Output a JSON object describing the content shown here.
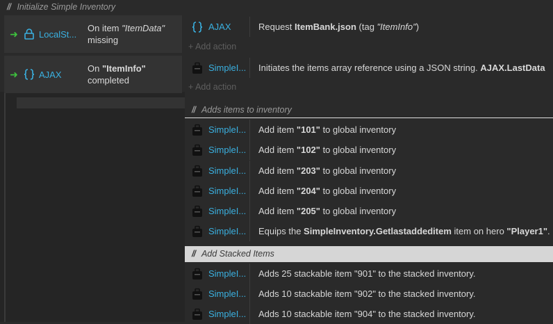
{
  "sheet": {
    "top_comment": "Initialize Simple Inventory",
    "events": [
      {
        "object": "LocalSt...",
        "condition_prefix": "On item ",
        "condition_tag": "\"ItemData\"",
        "condition_suffix": "missing",
        "action_object": "AJAX",
        "action_prefix": "Request ",
        "action_file": "ItemBank.json",
        "action_mid": " (tag ",
        "action_tag": "\"ItemInfo\"",
        "action_suffix": ")",
        "add_action": "+ Add action"
      },
      {
        "object": "AJAX",
        "condition_prefix": "On ",
        "condition_tag": "\"ItemInfo\"",
        "condition_suffix": "completed",
        "action_object": "SimpleI...",
        "action_text": "Initiates the items array reference using a JSON string. ",
        "action_bold": "AJAX.LastData",
        "add_action": "+ Add action"
      }
    ],
    "sub_comment_1": "Adds items to inventory",
    "add_items": [
      {
        "object": "SimpleI...",
        "prefix": "Add item ",
        "item": "\"101\"",
        "suffix": " to global inventory"
      },
      {
        "object": "SimpleI...",
        "prefix": "Add item ",
        "item": "\"102\"",
        "suffix": " to global inventory"
      },
      {
        "object": "SimpleI...",
        "prefix": "Add item ",
        "item": "\"203\"",
        "suffix": " to global inventory"
      },
      {
        "object": "SimpleI...",
        "prefix": "Add item ",
        "item": "\"204\"",
        "suffix": " to global inventory"
      },
      {
        "object": "SimpleI...",
        "prefix": "Add item ",
        "item": "\"205\"",
        "suffix": " to global inventory"
      }
    ],
    "equip": {
      "object": "SimpleI...",
      "prefix": "Equips the ",
      "expr": "SimpleInventory.Getlastaddeditem",
      "mid": " item on hero ",
      "hero": "\"Player1\"",
      "suffix": "."
    },
    "sub_comment_2": "Add Stacked Items",
    "stacked": [
      {
        "object": "SimpleI...",
        "text": "Adds 25 stackable item \"901\" to the stacked inventory."
      },
      {
        "object": "SimpleI...",
        "text": "Adds 10 stackable item \"902\" to the stacked inventory."
      },
      {
        "object": "SimpleI...",
        "text": "Adds 10 stackable item \"904\" to the stacked inventory."
      }
    ],
    "comment_slashes": "//",
    "arrow": "➜"
  },
  "colors": {
    "background": "#2a2a2a",
    "object_blue": "#3ab0e0",
    "trigger_green": "#3ec23e",
    "comment_gray": "#9a9a9a"
  },
  "icons": {
    "localstorage": "lock-icon",
    "ajax": "ajax-icon",
    "inventory": "backpack-icon"
  }
}
